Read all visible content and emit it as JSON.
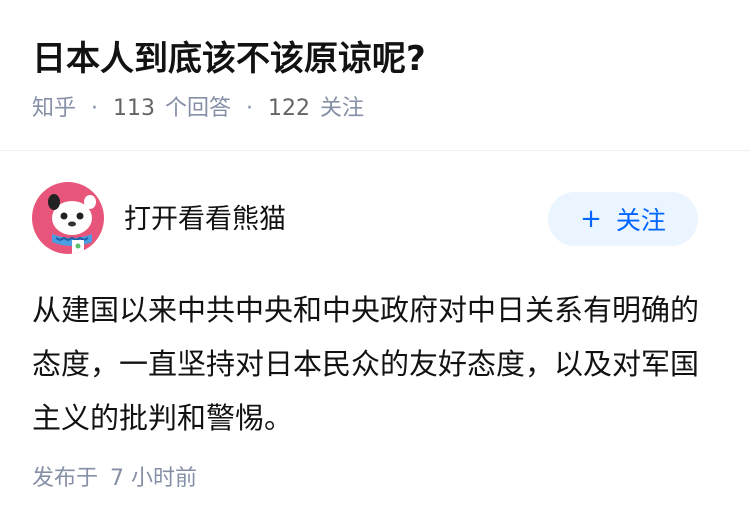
{
  "question": {
    "title": "日本人到底该不该原谅呢?",
    "source": "知乎",
    "separator": "·",
    "answer_count": "113",
    "answer_label": "个回答",
    "follower_count": "122",
    "follower_label": "关注"
  },
  "author": {
    "name": "打开看看熊猫",
    "avatar_icon": "panda-avatar-icon",
    "follow_plus": "+",
    "follow_label": "关注"
  },
  "answer": {
    "content": "从建国以来中共中央和中央政府对中日关系有明确的态度，一直坚持对日本民众的友好态度，以及对军国主义的批判和警惕。",
    "published_prefix": "发布于",
    "published_time": "7 小时前"
  },
  "colors": {
    "accent": "#0066ff",
    "follow_bg": "#ebf5ff",
    "meta_text": "#8590a6",
    "avatar_bg": "#e8557a"
  }
}
